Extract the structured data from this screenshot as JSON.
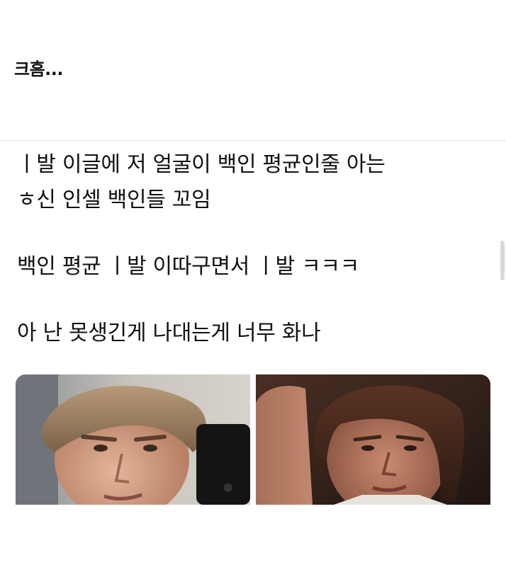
{
  "caption": "크흠...",
  "post": {
    "lines": [
      "ㅣ발 이글에 저 얼굴이 백인 평균인줄 아는",
      "ㅎ신 인셀 백인들 꼬임",
      "백인 평균   ㅣ발 이따구면서   ㅣ발 ㅋㅋㅋ",
      "아 난 못생긴게 나대는게 너무 화나"
    ]
  },
  "images": {
    "left": {
      "icon": "selfie-photo-icon"
    },
    "right": {
      "icon": "selfie-photo-icon"
    }
  }
}
